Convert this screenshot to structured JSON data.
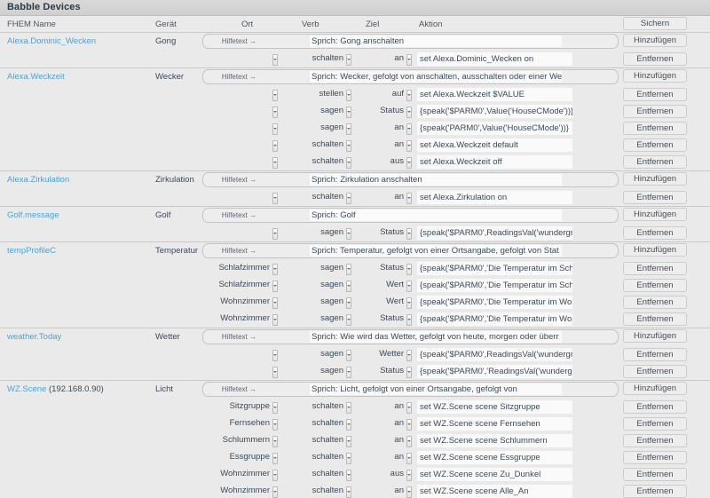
{
  "window": {
    "title": "Babble Devices"
  },
  "columns": {
    "fhem_name": "FHEM Name",
    "device": "Gerät",
    "place": "Ort",
    "verb": "Verb",
    "target": "Ziel",
    "action": "Aktion"
  },
  "buttons": {
    "save": "Sichern",
    "add": "Hinzufügen",
    "remove": "Entfernen"
  },
  "help_label": "Hilfetext →",
  "colors": {
    "link": "#4ba3d3",
    "text": "#3b4a5a",
    "panel": "#eaeaea",
    "titlebar": "#d9d9d9",
    "field": "#fafafa"
  },
  "devices": [
    {
      "fhem_name": "Alexa.Dominic_Wecken",
      "ip": "",
      "device": "Gong",
      "help_text": "Sprich: Gong anschalten",
      "rows": [
        {
          "place": "",
          "verb": "schalten",
          "target": "an",
          "action": "set Alexa.Dominic_Wecken on"
        }
      ]
    },
    {
      "fhem_name": "Alexa.Weckzeit",
      "ip": "",
      "device": "Wecker",
      "help_text": "Sprich: Wecker, gefolgt von anschalten, ausschalten oder einer We",
      "rows": [
        {
          "place": "",
          "verb": "stellen",
          "target": "auf",
          "action": "set Alexa.Weckzeit $VALUE"
        },
        {
          "place": "",
          "verb": "sagen",
          "target": "Status",
          "action": "{speak('$PARM0',Value('HouseCMode'))}"
        },
        {
          "place": "",
          "verb": "sagen",
          "target": "an",
          "action": "{speak('PARM0',Value('HouseCMode'))}"
        },
        {
          "place": "",
          "verb": "schalten",
          "target": "an",
          "action": "set Alexa.Weckzeit default"
        },
        {
          "place": "",
          "verb": "schalten",
          "target": "aus",
          "action": "set Alexa.Weckzeit off"
        }
      ]
    },
    {
      "fhem_name": "Alexa.Zirkulation",
      "ip": "",
      "device": "Zirkulation",
      "help_text": "Sprich: Zirkulation anschalten",
      "rows": [
        {
          "place": "",
          "verb": "schalten",
          "target": "an",
          "action": "set Alexa.Zirkulation on"
        }
      ]
    },
    {
      "fhem_name": "Golf.message",
      "ip": "",
      "device": "Golf",
      "help_text": "Sprich: Golf",
      "rows": [
        {
          "place": "",
          "verb": "sagen",
          "target": "Status",
          "action": "{speak('$PARM0',ReadingsVal('wundergr"
        }
      ]
    },
    {
      "fhem_name": "tempProfileC",
      "ip": "",
      "device": "Temperatur",
      "help_text": "Sprich: Temperatur, gefolgt von einer Ortsangabe, gefolgt von Stat",
      "rows": [
        {
          "place": "Schlafzimmer",
          "verb": "sagen",
          "target": "Status",
          "action": "{speak('$PARM0','Die Temperatur im Sch"
        },
        {
          "place": "Schlafzimmer",
          "verb": "sagen",
          "target": "Wert",
          "action": "{speak('$PARM0','Die Temperatur im Sch"
        },
        {
          "place": "Wohnzimmer",
          "verb": "sagen",
          "target": "Wert",
          "action": "{speak('$PARM0','Die Temperatur im Wo"
        },
        {
          "place": "Wohnzimmer",
          "verb": "sagen",
          "target": "Status",
          "action": "{speak('$PARM0','Die Temperatur im Wo"
        }
      ]
    },
    {
      "fhem_name": "weather.Today",
      "ip": "",
      "device": "Wetter",
      "help_text": "Sprich: Wie wird das Wetter, gefolgt von heute, morgen oder überr",
      "rows": [
        {
          "place": "",
          "verb": "sagen",
          "target": "Wetter",
          "action": "{speak('$PARM0',ReadingsVal('wundergr"
        },
        {
          "place": "",
          "verb": "sagen",
          "target": "Status",
          "action": "{speak('$PARM0','ReadingsVal('wunderg"
        }
      ]
    },
    {
      "fhem_name": "WZ.Scene",
      "ip": "(192.168.0.90)",
      "device": "Licht",
      "help_text": "Sprich: Licht, gefolgt von einer Ortsangabe, gefolgt von",
      "rows": [
        {
          "place": "Sitzgruppe",
          "verb": "schalten",
          "target": "an",
          "action": "set WZ.Scene scene Sitzgruppe"
        },
        {
          "place": "Fernsehen",
          "verb": "schalten",
          "target": "an",
          "action": "set WZ.Scene scene Fernsehen"
        },
        {
          "place": "Schlummern",
          "verb": "schalten",
          "target": "an",
          "action": "set WZ.Scene scene Schlummern"
        },
        {
          "place": "Essgruppe",
          "verb": "schalten",
          "target": "an",
          "action": "set WZ.Scene scene Essgruppe"
        },
        {
          "place": "Wohnzimmer",
          "verb": "schalten",
          "target": "aus",
          "action": "set WZ.Scene scene Zu_Dunkel"
        },
        {
          "place": "Wohnzimmer",
          "verb": "schalten",
          "target": "an",
          "action": "set WZ.Scene scene Alle_An"
        }
      ]
    }
  ]
}
